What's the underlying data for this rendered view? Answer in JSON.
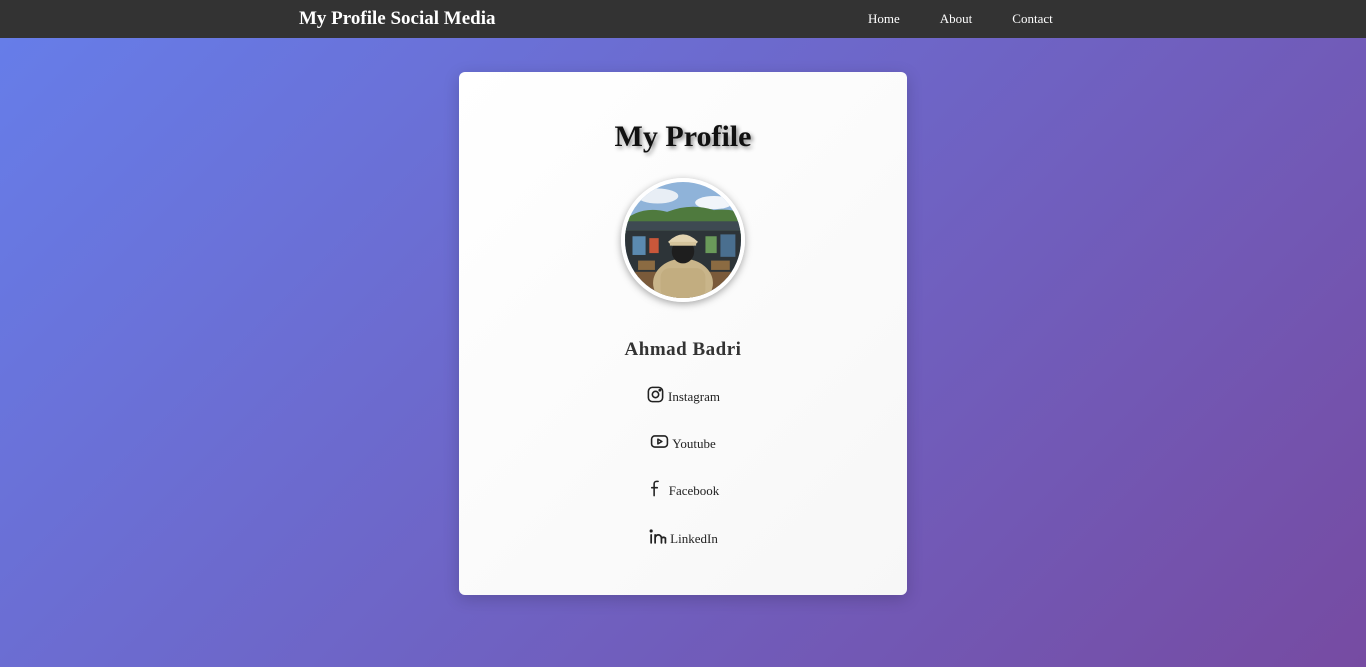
{
  "navbar": {
    "brand": "My Profile Social Media",
    "links": [
      {
        "label": "Home"
      },
      {
        "label": "About"
      },
      {
        "label": "Contact"
      }
    ]
  },
  "card": {
    "title": "My Profile",
    "name": "Ahmad Badri",
    "socials": [
      {
        "label": "Instagram",
        "icon": "instagram-icon"
      },
      {
        "label": "Youtube",
        "icon": "youtube-icon"
      },
      {
        "label": "Facebook",
        "icon": "facebook-icon"
      },
      {
        "label": "LinkedIn",
        "icon": "linkedin-icon"
      }
    ]
  },
  "colors": {
    "navbar_bg": "#333333",
    "gradient_start": "#667eea",
    "gradient_end": "#764ba2",
    "card_bg": "#ffffff",
    "text_dark": "#333333"
  }
}
